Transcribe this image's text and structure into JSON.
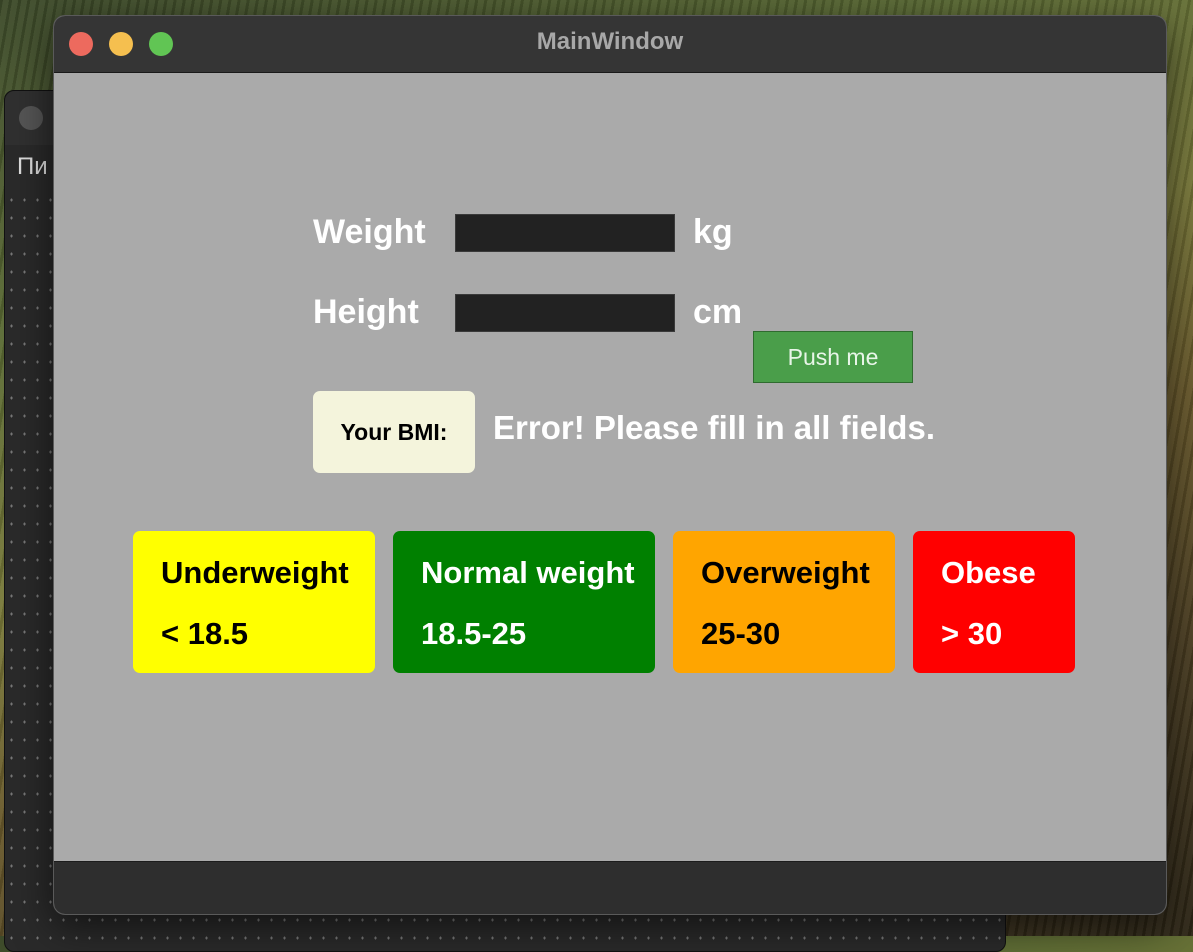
{
  "window": {
    "title": "MainWindow"
  },
  "background_window": {
    "menu_text": "Пи"
  },
  "form": {
    "weight_label": "Weight",
    "weight_value": "",
    "weight_unit": "kg",
    "height_label": "Height",
    "height_value": "",
    "height_unit": "cm",
    "push_button_label": "Push me"
  },
  "result": {
    "bmi_label": "Your BMI:",
    "message": "Error! Please fill in all fields."
  },
  "categories": [
    {
      "name": "Underweight",
      "range": "< 18.5",
      "bg": "#ffff00",
      "fg": "#000000"
    },
    {
      "name": "Normal weight",
      "range": "18.5-25",
      "bg": "#008000",
      "fg": "#ffffff"
    },
    {
      "name": "Overweight",
      "range": "25-30",
      "bg": "#ffa500",
      "fg": "#000000"
    },
    {
      "name": "Obese",
      "range": "> 30",
      "bg": "#ff0000",
      "fg": "#ffffff"
    }
  ],
  "colors": {
    "window_bg": "#aaaaaa",
    "titlebar": "#353535",
    "button_green": "#4a9e4a",
    "bmi_box": "#f4f4dc"
  }
}
